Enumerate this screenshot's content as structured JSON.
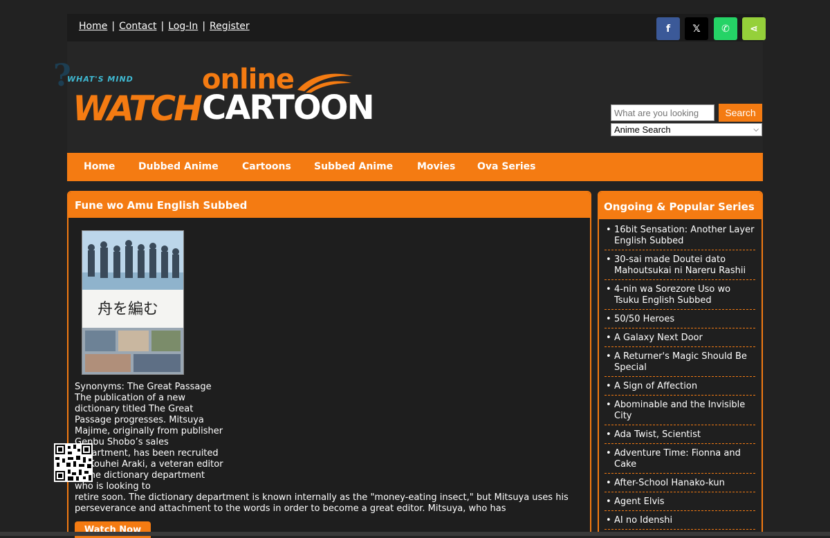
{
  "toplinks": [
    "Home",
    "Contact",
    "Log-In",
    "Register"
  ],
  "share": [
    {
      "name": "facebook-share-button",
      "glyph": "f",
      "bg": "#3b5998"
    },
    {
      "name": "x-share-button",
      "glyph": "𝕏",
      "bg": "#000000"
    },
    {
      "name": "whatsapp-share-button",
      "glyph": "✆",
      "bg": "#25d366"
    },
    {
      "name": "sharethis-button",
      "glyph": "⋖",
      "bg": "#95d03a"
    }
  ],
  "logo": {
    "small": "WHAT'S MIND",
    "online": "online",
    "watch": "WATCH",
    "cartoon": "CARTOON"
  },
  "search": {
    "placeholder": "What are you looking",
    "button": "Search",
    "select": "Anime Search"
  },
  "nav": [
    "Home",
    "Dubbed Anime",
    "Cartoons",
    "Subbed Anime",
    "Movies",
    "Ova Series"
  ],
  "main": {
    "title": "Fune wo Amu English Subbed",
    "poster_title": "舟を編む",
    "synonyms": "Synonyms: The Great Passage",
    "desc_narrow": "The publication of a new dictionary titled The Great Passage progresses. Mitsuya Majime, originally from publisher Genbu Shobo’s sales department, has been recruited by Kouhei Araki, a veteran editor of the dictionary department who is looking to",
    "desc_wide": "retire soon. The dictionary department is known internally as the \"money-eating insect,\" but Mitsuya uses his perseverance and attachment to the words in order to become a great editor. Mitsuya, who has",
    "watch_button": "Watch Now"
  },
  "sidebar": {
    "title": "Ongoing & Popular Series",
    "items": [
      "16bit Sensation: Another Layer English Subbed",
      "30-sai made Doutei dato Mahoutsukai ni Nareru Rashii",
      "4-nin wa Sorezore Uso wo Tsuku English Subbed",
      "50/50 Heroes",
      "A Galaxy Next Door",
      "A Returner's Magic Should Be Special",
      "A Sign of Affection",
      "Abominable and the Invisible City",
      "Ada Twist, Scientist",
      "Adventure Time: Fionna and Cake",
      "After-School Hanako-kun",
      "Agent Elvis",
      "AI no Idenshi"
    ]
  },
  "colors": {
    "accent": "#f47b12",
    "background": "#222222"
  }
}
